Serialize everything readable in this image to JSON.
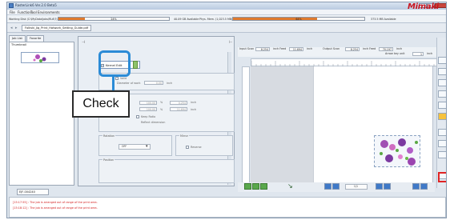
{
  "window": {
    "title": "RasterLink6 Ver.2.0 Beta5"
  },
  "menu": [
    "File",
    "Function",
    "Tool",
    "Environments"
  ],
  "status": {
    "working_disk": "Working Disk (C:\\MyData\\Jobs\\RL6\\?)",
    "progress_left": {
      "label": "24%",
      "fraction": 0.24
    },
    "available": "40.09 GB Available",
    "phys_mem": "Phys. Mem. (1,023.5 MB)",
    "progress_mid": {
      "label": "64%",
      "fraction": 0.64
    },
    "available2": "373.5 MB Available",
    "brand": "Mimaki",
    "accent": "#e07a2e",
    "brand_color": "#c8141e"
  },
  "file_tab": "Folkski_Jig_Print_Hatwork_Setting_Guide.pdf",
  "left_tabs": [
    "Job List",
    "Favorite"
  ],
  "thumbnail_label": "Thumbnail",
  "options": {
    "kerning_edit": "Kernel Edit",
    "valid": "Valid",
    "diameter": "Diameter of work",
    "diameter_value": "0.00",
    "unit": "inch",
    "circumference": "Circumference",
    "circ_value": "100.00",
    "percent": "%",
    "circ_inch": "0.254",
    "feed": "Feed",
    "feed_value": "100.00",
    "feed_inch": "11.694",
    "keep_ratio": "Keep Ratio",
    "reflect": "Reflect dimension",
    "rotation_caption": "Rotation",
    "rotation_value": "OFF",
    "mirror_caption": "Mirror",
    "reverse": "Reverse",
    "position_caption": "Position"
  },
  "preview": {
    "input_scan_label": "Input Scan",
    "input_scan": "8.254",
    "input_feed_label": "inch Feed",
    "input_feed": "11.694",
    "inch1": "inch",
    "output_scan_label": "Output Scan",
    "output_scan": "8.254",
    "output_feed_label": "inch Feed",
    "output_feed": "70.197",
    "inch2": "inch",
    "arrow_key_unit": "Arrow key unit",
    "arrow_key_value": "1",
    "arrow_inch": "inch",
    "page": "1/1"
  },
  "job_tab": "EJF-004240",
  "log": [
    "[15:17:55] : The job is arranged out of range of the print area.",
    "[15:18:12] : The job is arranged out of range of the print area."
  ],
  "annotation": {
    "label": "Check",
    "color": "#2b8bd6"
  }
}
